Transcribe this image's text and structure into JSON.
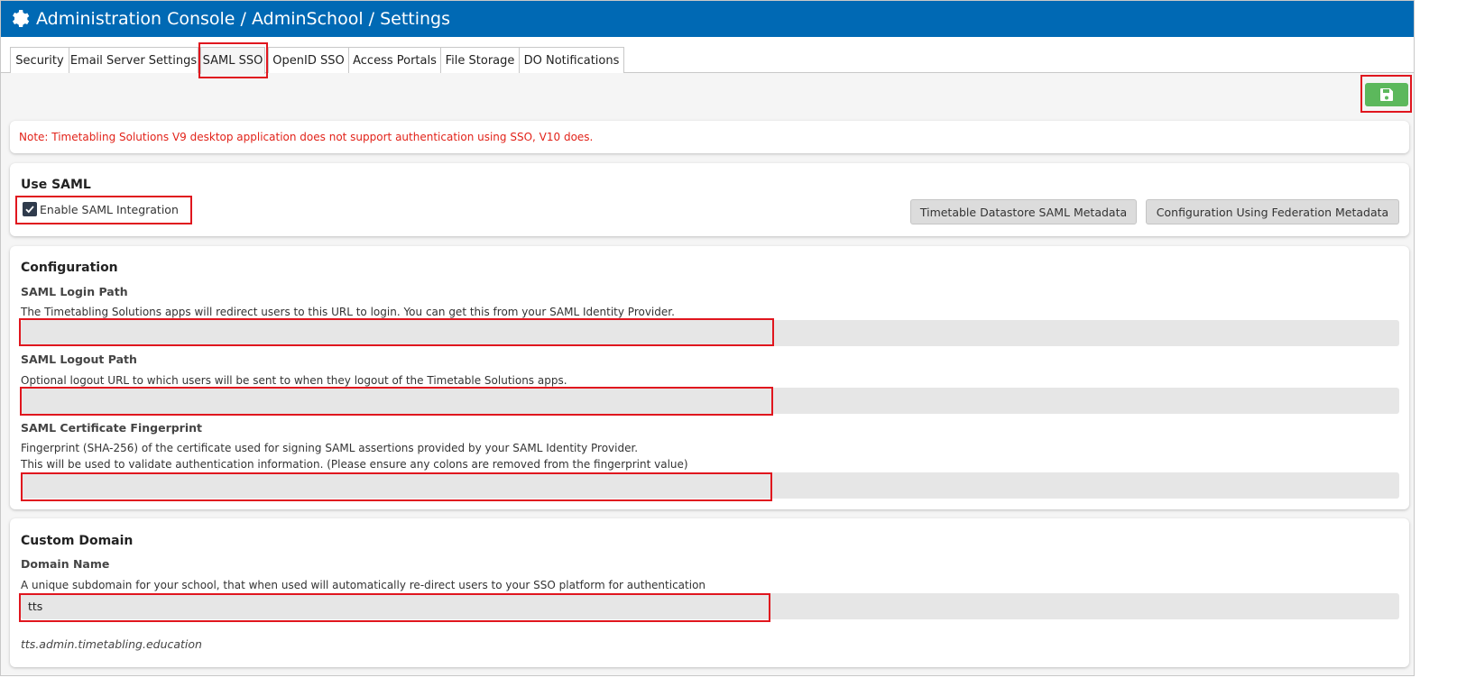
{
  "header": {
    "title": "Administration Console / AdminSchool / Settings",
    "icon": "gear-icon"
  },
  "tabs": [
    {
      "label": "Security"
    },
    {
      "label": "Email Server Settings"
    },
    {
      "label": "SAML SSO",
      "active": true
    },
    {
      "label": "OpenID SSO"
    },
    {
      "label": "Access Portals"
    },
    {
      "label": "File Storage"
    },
    {
      "label": "DO Notifications"
    }
  ],
  "toolbar": {
    "save_icon": "floppy-disk-icon",
    "save_color": "#5cb85c"
  },
  "note": "Note: Timetabling Solutions V9 desktop application does not support authentication using SSO, V10 does.",
  "use_saml": {
    "title": "Use SAML",
    "checkbox_label": "Enable SAML Integration",
    "checked": true,
    "buttons": {
      "metadata": "Timetable Datastore SAML Metadata",
      "federation": "Configuration Using Federation Metadata"
    }
  },
  "configuration": {
    "title": "Configuration",
    "login": {
      "label": "SAML Login Path",
      "description": "The Timetabling Solutions apps will redirect users to this URL to login. You can get this from your SAML Identity Provider.",
      "value": ""
    },
    "logout": {
      "label": "SAML Logout Path",
      "description": "Optional logout URL to which users will be sent to when they logout of the Timetable Solutions apps.",
      "value": ""
    },
    "fingerprint": {
      "label": "SAML Certificate Fingerprint",
      "description1": "Fingerprint (SHA-256) of the certificate used for signing SAML assertions provided by your SAML Identity Provider.",
      "description2": "This will be used to validate authentication information. (Please ensure any colons are removed from the fingerprint value)",
      "value": ""
    }
  },
  "custom_domain": {
    "title": "Custom Domain",
    "label": "Domain Name",
    "description": "A unique subdomain for your school, that when used will automatically re-direct users to your SSO platform for authentication",
    "value": "tts",
    "preview": "tts.admin.timetabling.education"
  },
  "colors": {
    "header_bg": "#0069b4",
    "note_text": "#e2231a",
    "highlight": "#e0161e"
  }
}
